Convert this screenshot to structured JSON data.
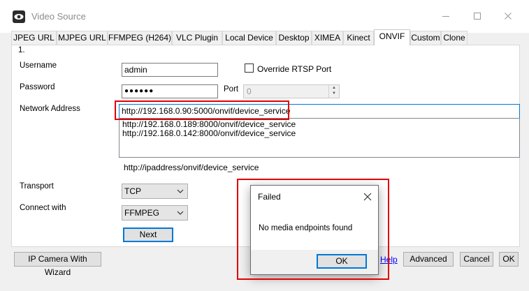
{
  "window": {
    "title": "Video Source"
  },
  "tabs": [
    {
      "label": "JPEG URL"
    },
    {
      "label": "MJPEG URL"
    },
    {
      "label": "FFMPEG (H264)"
    },
    {
      "label": "VLC Plugin"
    },
    {
      "label": "Local Device"
    },
    {
      "label": "Desktop"
    },
    {
      "label": "XIMEA"
    },
    {
      "label": "Kinect"
    },
    {
      "label": "ONVIF"
    },
    {
      "label": "Custom"
    },
    {
      "label": "Clone"
    }
  ],
  "active_tab": "ONVIF",
  "form": {
    "step": "1.",
    "username_label": "Username",
    "username_value": "admin",
    "override_rtsp_label": "Override RTSP Port",
    "override_rtsp_checked": false,
    "password_label": "Password",
    "password_value": "●●●●●●",
    "port_label": "Port",
    "port_value": "0",
    "network_address_label": "Network Address",
    "network_address_value": "http://192.168.0.90:5000/onvif/device_service",
    "discovered": [
      "http://192.168.0.189:8000/onvif/device_service",
      "http://192.168.0.142:8000/onvif/device_service"
    ],
    "address_hint": "http://ipaddress/onvif/device_service",
    "transport_label": "Transport",
    "transport_value": "TCP",
    "connect_with_label": "Connect with",
    "connect_with_value": "FFMPEG",
    "next_label": "Next"
  },
  "footer": {
    "wizard_label": "IP Camera With Wizard",
    "help_label": "Help",
    "advanced_label": "Advanced",
    "cancel_label": "Cancel",
    "ok_label": "OK"
  },
  "dialog": {
    "title": "Failed",
    "message": "No media endpoints found",
    "ok_label": "OK"
  },
  "colors": {
    "accent": "#0078d7",
    "highlight": "#e00000",
    "link": "#0000ff"
  }
}
